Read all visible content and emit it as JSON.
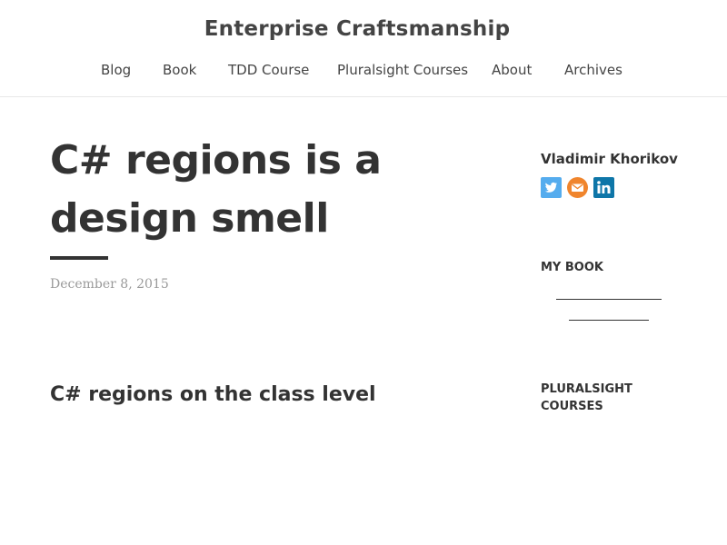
{
  "header": {
    "site_title": "Enterprise Craftsmanship",
    "nav": [
      {
        "label": "Blog"
      },
      {
        "label": "Book"
      },
      {
        "label": "TDD Course"
      },
      {
        "label": "Pluralsight Courses"
      },
      {
        "label": "About"
      },
      {
        "label": "Archives"
      }
    ]
  },
  "post": {
    "title": "C# regions is a design smell",
    "date": "December 8, 2015",
    "section_heading": "C# regions on the class level"
  },
  "sidebar": {
    "author": "Vladimir Khorikov",
    "social": [
      {
        "icon": "twitter-icon",
        "color": "#55acee"
      },
      {
        "icon": "email-icon",
        "color": "#f0852d"
      },
      {
        "icon": "linkedin-icon",
        "color": "#0e76a8"
      }
    ],
    "my_book_title": "MY BOOK",
    "pluralsight_title": "PLURALSIGHT COURSES"
  }
}
